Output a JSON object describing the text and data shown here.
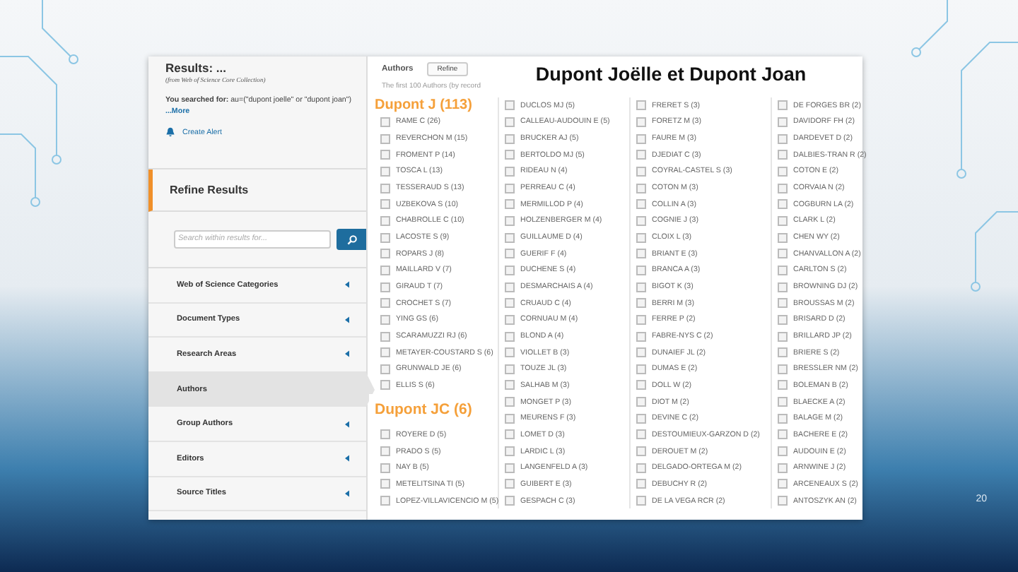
{
  "slide": {
    "title_overlay": "Dupont Joëlle et Dupont Joan",
    "page_number": "20"
  },
  "sidebar": {
    "results_title": "Results: ...",
    "results_source": "(from Web of Science Core Collection)",
    "search_summary": "**You searched for:** au=(\"dupont joelle\" or \"dupont joan\")",
    "more_link": "...More",
    "create_alert": "Create Alert",
    "refine_title": "Refine Results",
    "search": {
      "placeholder": "Search within results for..."
    },
    "nav_items": [
      {
        "label": "Web of Science Categories",
        "selected": false
      },
      {
        "label": "Document Types",
        "selected": false
      },
      {
        "label": "Research Areas",
        "selected": false
      },
      {
        "label": "Authors",
        "selected": true
      },
      {
        "label": "Group Authors",
        "selected": false
      },
      {
        "label": "Editors",
        "selected": false
      },
      {
        "label": "Source Titles",
        "selected": false
      }
    ]
  },
  "authors_panel": {
    "heading": "Authors",
    "refine_button": "Refine",
    "note": "The first 100 Authors (by record",
    "columns": [
      [
        {
          "kind": "callout",
          "text": "Dupont J (113)"
        },
        {
          "kind": "author",
          "name": "RAME C (26)",
          "checked": false
        },
        {
          "kind": "author",
          "name": "REVERCHON M (15)",
          "checked": false
        },
        {
          "kind": "author",
          "name": "FROMENT P (14)",
          "checked": false
        },
        {
          "kind": "author",
          "name": "TOSCA L (13)",
          "checked": false
        },
        {
          "kind": "author",
          "name": "TESSERAUD S (13)",
          "checked": false
        },
        {
          "kind": "author",
          "name": "UZBEKOVA S (10)",
          "checked": false
        },
        {
          "kind": "author",
          "name": "CHABROLLE C (10)",
          "checked": false
        },
        {
          "kind": "author",
          "name": "LACOSTE S (9)",
          "checked": false
        },
        {
          "kind": "author",
          "name": "ROPARS J (8)",
          "checked": false
        },
        {
          "kind": "author",
          "name": "MAILLARD V (7)",
          "checked": false
        },
        {
          "kind": "author",
          "name": "GIRAUD T (7)",
          "checked": false
        },
        {
          "kind": "author",
          "name": "CROCHET S (7)",
          "checked": false
        },
        {
          "kind": "author",
          "name": "YING GS (6)",
          "checked": false
        },
        {
          "kind": "author",
          "name": "SCARAMUZZI RJ (6)",
          "checked": false
        },
        {
          "kind": "author",
          "name": "METAYER-COUSTARD S (6)",
          "checked": false
        },
        {
          "kind": "author",
          "name": "GRUNWALD JE (6)",
          "checked": false
        },
        {
          "kind": "author",
          "name": "ELLIS S (6)",
          "checked": false
        },
        {
          "kind": "callout",
          "text": "Dupont JC (6)"
        },
        {
          "kind": "author",
          "name": "ROYERE D (5)",
          "checked": false
        },
        {
          "kind": "author",
          "name": "PRADO S (5)",
          "checked": false
        },
        {
          "kind": "author",
          "name": "NAY B (5)",
          "checked": false
        },
        {
          "kind": "author",
          "name": "METELITSINA TI (5)",
          "checked": false
        },
        {
          "kind": "author",
          "name": "LOPEZ-VILLAVICENCIO M (5)",
          "checked": false
        }
      ],
      [
        {
          "kind": "author",
          "name": "DUCLOS MJ (5)",
          "checked": false
        },
        {
          "kind": "author",
          "name": "CALLEAU-AUDOUIN E (5)",
          "checked": false
        },
        {
          "kind": "author",
          "name": "BRUCKER AJ (5)",
          "checked": false
        },
        {
          "kind": "author",
          "name": "BERTOLDO MJ (5)",
          "checked": false
        },
        {
          "kind": "author",
          "name": "RIDEAU N (4)",
          "checked": false
        },
        {
          "kind": "author",
          "name": "PERREAU C (4)",
          "checked": false
        },
        {
          "kind": "author",
          "name": "MERMILLOD P (4)",
          "checked": false
        },
        {
          "kind": "author",
          "name": "HOLZENBERGER M (4)",
          "checked": false
        },
        {
          "kind": "author",
          "name": "GUILLAUME D (4)",
          "checked": false
        },
        {
          "kind": "author",
          "name": "GUERIF F (4)",
          "checked": false
        },
        {
          "kind": "author",
          "name": "DUCHENE S (4)",
          "checked": false
        },
        {
          "kind": "author",
          "name": "DESMARCHAIS A (4)",
          "checked": false
        },
        {
          "kind": "author",
          "name": "CRUAUD C (4)",
          "checked": false
        },
        {
          "kind": "author",
          "name": "CORNUAU M (4)",
          "checked": false
        },
        {
          "kind": "author",
          "name": "BLOND A (4)",
          "checked": false
        },
        {
          "kind": "author",
          "name": "VIOLLET B (3)",
          "checked": false
        },
        {
          "kind": "author",
          "name": "TOUZE JL (3)",
          "checked": false
        },
        {
          "kind": "author",
          "name": "SALHAB M (3)",
          "checked": false
        },
        {
          "kind": "author",
          "name": "MONGET P (3)",
          "checked": false
        },
        {
          "kind": "author",
          "name": "MEURENS F (3)",
          "checked": false
        },
        {
          "kind": "author",
          "name": "LOMET D (3)",
          "checked": false
        },
        {
          "kind": "author",
          "name": "LARDIC L (3)",
          "checked": false
        },
        {
          "kind": "author",
          "name": "LANGENFELD A (3)",
          "checked": false
        },
        {
          "kind": "author",
          "name": "GUIBERT E (3)",
          "checked": false
        },
        {
          "kind": "author",
          "name": "GESPACH C (3)",
          "checked": false
        }
      ],
      [
        {
          "kind": "author",
          "name": "FRERET S (3)",
          "checked": false
        },
        {
          "kind": "author",
          "name": "FORETZ M (3)",
          "checked": false
        },
        {
          "kind": "author",
          "name": "FAURE M (3)",
          "checked": false
        },
        {
          "kind": "author",
          "name": "DJEDIAT C (3)",
          "checked": false
        },
        {
          "kind": "author",
          "name": "COYRAL-CASTEL S (3)",
          "checked": false
        },
        {
          "kind": "author",
          "name": "COTON M (3)",
          "checked": false
        },
        {
          "kind": "author",
          "name": "COLLIN A (3)",
          "checked": false
        },
        {
          "kind": "author",
          "name": "COGNIE J (3)",
          "checked": false
        },
        {
          "kind": "author",
          "name": "CLOIX L (3)",
          "checked": false
        },
        {
          "kind": "author",
          "name": "BRIANT E (3)",
          "checked": false
        },
        {
          "kind": "author",
          "name": "BRANCA A (3)",
          "checked": false
        },
        {
          "kind": "author",
          "name": "BIGOT K (3)",
          "checked": false
        },
        {
          "kind": "author",
          "name": "BERRI M (3)",
          "checked": false
        },
        {
          "kind": "author",
          "name": "FERRE P (2)",
          "checked": false
        },
        {
          "kind": "author",
          "name": "FABRE-NYS C (2)",
          "checked": false
        },
        {
          "kind": "author",
          "name": "DUNAIEF JL (2)",
          "checked": false
        },
        {
          "kind": "author",
          "name": "DUMAS E (2)",
          "checked": false
        },
        {
          "kind": "author",
          "name": "DOLL W (2)",
          "checked": false
        },
        {
          "kind": "author",
          "name": "DIOT M (2)",
          "checked": false
        },
        {
          "kind": "author",
          "name": "DEVINE C (2)",
          "checked": false
        },
        {
          "kind": "author",
          "name": "DESTOUMIEUX-GARZON D (2)",
          "checked": false
        },
        {
          "kind": "author",
          "name": "DEROUET M (2)",
          "checked": false
        },
        {
          "kind": "author",
          "name": "DELGADO-ORTEGA M (2)",
          "checked": false
        },
        {
          "kind": "author",
          "name": "DEBUCHY R (2)",
          "checked": false
        },
        {
          "kind": "author",
          "name": "DE LA VEGA RCR (2)",
          "checked": false
        }
      ],
      [
        {
          "kind": "author",
          "name": "DE FORGES BR (2)",
          "checked": false
        },
        {
          "kind": "author",
          "name": "DAVIDORF FH (2)",
          "checked": false
        },
        {
          "kind": "author",
          "name": "DARDEVET D (2)",
          "checked": false
        },
        {
          "kind": "author",
          "name": "DALBIES-TRAN R (2)",
          "checked": false
        },
        {
          "kind": "author",
          "name": "COTON E (2)",
          "checked": false
        },
        {
          "kind": "author",
          "name": "CORVAIA N (2)",
          "checked": false
        },
        {
          "kind": "author",
          "name": "COGBURN LA (2)",
          "checked": false
        },
        {
          "kind": "author",
          "name": "CLARK L (2)",
          "checked": false
        },
        {
          "kind": "author",
          "name": "CHEN WY (2)",
          "checked": false
        },
        {
          "kind": "author",
          "name": "CHANVALLON A (2)",
          "checked": false
        },
        {
          "kind": "author",
          "name": "CARLTON S (2)",
          "checked": false
        },
        {
          "kind": "author",
          "name": "BROWNING DJ (2)",
          "checked": false
        },
        {
          "kind": "author",
          "name": "BROUSSAS M (2)",
          "checked": false
        },
        {
          "kind": "author",
          "name": "BRISARD D (2)",
          "checked": false
        },
        {
          "kind": "author",
          "name": "BRILLARD JP (2)",
          "checked": false
        },
        {
          "kind": "author",
          "name": "BRIERE S (2)",
          "checked": false
        },
        {
          "kind": "author",
          "name": "BRESSLER NM (2)",
          "checked": false
        },
        {
          "kind": "author",
          "name": "BOLEMAN B (2)",
          "checked": false
        },
        {
          "kind": "author",
          "name": "BLAECKE A (2)",
          "checked": false
        },
        {
          "kind": "author",
          "name": "BALAGE M (2)",
          "checked": false
        },
        {
          "kind": "author",
          "name": "BACHERE E (2)",
          "checked": false
        },
        {
          "kind": "author",
          "name": "AUDOUIN E (2)",
          "checked": false
        },
        {
          "kind": "author",
          "name": "ARNWINE J (2)",
          "checked": false
        },
        {
          "kind": "author",
          "name": "ARCENEAUX S (2)",
          "checked": false
        },
        {
          "kind": "author",
          "name": "ANTOSZYK AN (2)",
          "checked": false
        }
      ]
    ]
  }
}
